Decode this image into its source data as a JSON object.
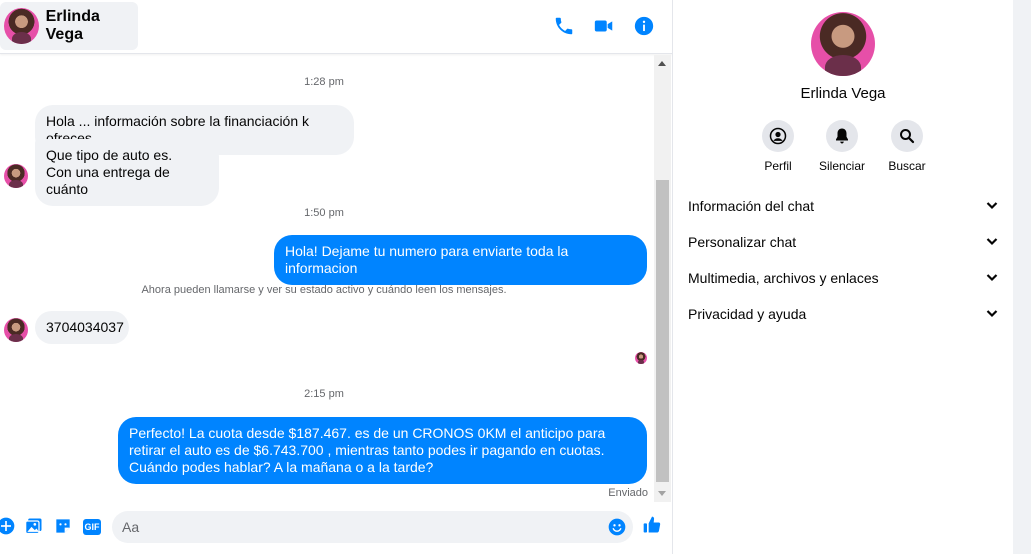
{
  "header": {
    "contact_name": "Erlinda Vega",
    "icons": [
      "phone-icon",
      "video-camera-icon",
      "info-icon"
    ]
  },
  "conversation": {
    "timestamps": [
      "1:28 pm",
      "1:50 pm",
      "2:15 pm"
    ],
    "messages": [
      {
        "from": "contact",
        "text": "Hola ... información sobre la financiación k ofreces"
      },
      {
        "from": "contact",
        "text": "Que tipo de auto es.\nCon una entrega de cuánto"
      },
      {
        "from": "me",
        "text": "Hola! Dejame tu numero  para enviarte toda la informacion"
      },
      {
        "from": "contact",
        "text": "3704034037"
      },
      {
        "from": "me",
        "text": "Perfecto! La cuota desde $187.467. es de un CRONOS 0KM el anticipo para retirar el auto es de $6.743.700 , mientras tanto podes ir pagando en cuotas. Cuándo podes hablar? A la mañana o a la tarde?"
      }
    ],
    "notice": "Ahora pueden llamarse y ver su estado activo y cuándo leen los mensajes.",
    "sent_status": "Enviado"
  },
  "composer": {
    "placeholder": "Aa",
    "gif_label": "GIF",
    "icons": [
      "plus-icon",
      "image-icon",
      "sticker-icon",
      "gif-icon",
      "emoji-icon",
      "thumbs-up-icon"
    ]
  },
  "info_panel": {
    "name": "Erlinda Vega",
    "actions": [
      {
        "label": "Perfil",
        "icon": "profile-icon"
      },
      {
        "label": "Silenciar",
        "icon": "bell-icon"
      },
      {
        "label": "Buscar",
        "icon": "search-icon"
      }
    ],
    "sections": [
      "Información del chat",
      "Personalizar chat",
      "Multimedia, archivos y enlaces",
      "Privacidad y ayuda"
    ]
  },
  "colors": {
    "accent": "#0084ff",
    "incoming_bubble": "#f0f2f5",
    "secondary_text": "#65676b"
  }
}
